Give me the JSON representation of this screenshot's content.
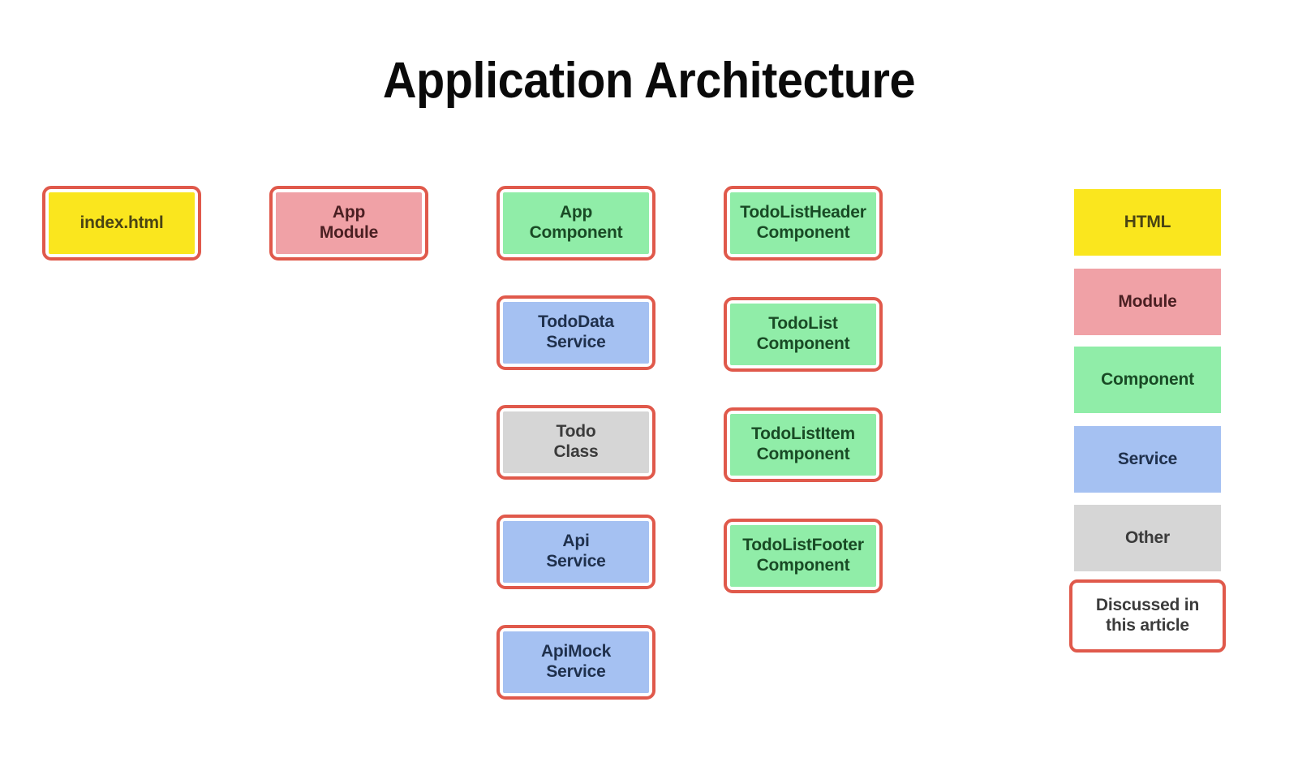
{
  "title": "Application Architecture",
  "palette": {
    "border_red": "#e0594b",
    "html_fill": "#fae61e",
    "module_fill": "#f0a1a6",
    "component_fill": "#90eda8",
    "service_fill": "#a5c1f2",
    "other_fill": "#d6d6d6",
    "background": "#ffffff"
  },
  "columns": [
    {
      "id": "entry",
      "nodes": [
        {
          "id": "index-html",
          "label": "index.html",
          "category": "html",
          "highlighted": true
        }
      ]
    },
    {
      "id": "modules",
      "nodes": [
        {
          "id": "app-module",
          "label": "App\nModule",
          "category": "module",
          "highlighted": true
        }
      ]
    },
    {
      "id": "app-core",
      "nodes": [
        {
          "id": "app-component",
          "label": "App\nComponent",
          "category": "component",
          "highlighted": true
        },
        {
          "id": "tododata-service",
          "label": "TodoData\nService",
          "category": "service",
          "highlighted": true
        },
        {
          "id": "todo-class",
          "label": "Todo\nClass",
          "category": "other",
          "highlighted": true
        },
        {
          "id": "api-service",
          "label": "Api\nService",
          "category": "service",
          "highlighted": true
        },
        {
          "id": "apimock-service",
          "label": "ApiMock\nService",
          "category": "service",
          "highlighted": true
        }
      ]
    },
    {
      "id": "todo-components",
      "nodes": [
        {
          "id": "todolistheader-component",
          "label": "TodoListHeader\nComponent",
          "category": "component",
          "highlighted": true
        },
        {
          "id": "todolist-component",
          "label": "TodoList\nComponent",
          "category": "component",
          "highlighted": true
        },
        {
          "id": "todolistitem-component",
          "label": "TodoListItem\nComponent",
          "category": "component",
          "highlighted": true
        },
        {
          "id": "todolistfooter-component",
          "label": "TodoListFooter\nComponent",
          "category": "component",
          "highlighted": true
        }
      ]
    }
  ],
  "legend": {
    "items": [
      {
        "id": "legend-html",
        "label": "HTML",
        "category": "html",
        "outlined": false
      },
      {
        "id": "legend-module",
        "label": "Module",
        "category": "module",
        "outlined": false
      },
      {
        "id": "legend-component",
        "label": "Component",
        "category": "component",
        "outlined": false
      },
      {
        "id": "legend-service",
        "label": "Service",
        "category": "service",
        "outlined": false
      },
      {
        "id": "legend-other",
        "label": "Other",
        "category": "other",
        "outlined": false
      },
      {
        "id": "legend-discussed",
        "label": "Discussed in\nthis article",
        "category": "plain",
        "outlined": true
      }
    ]
  }
}
